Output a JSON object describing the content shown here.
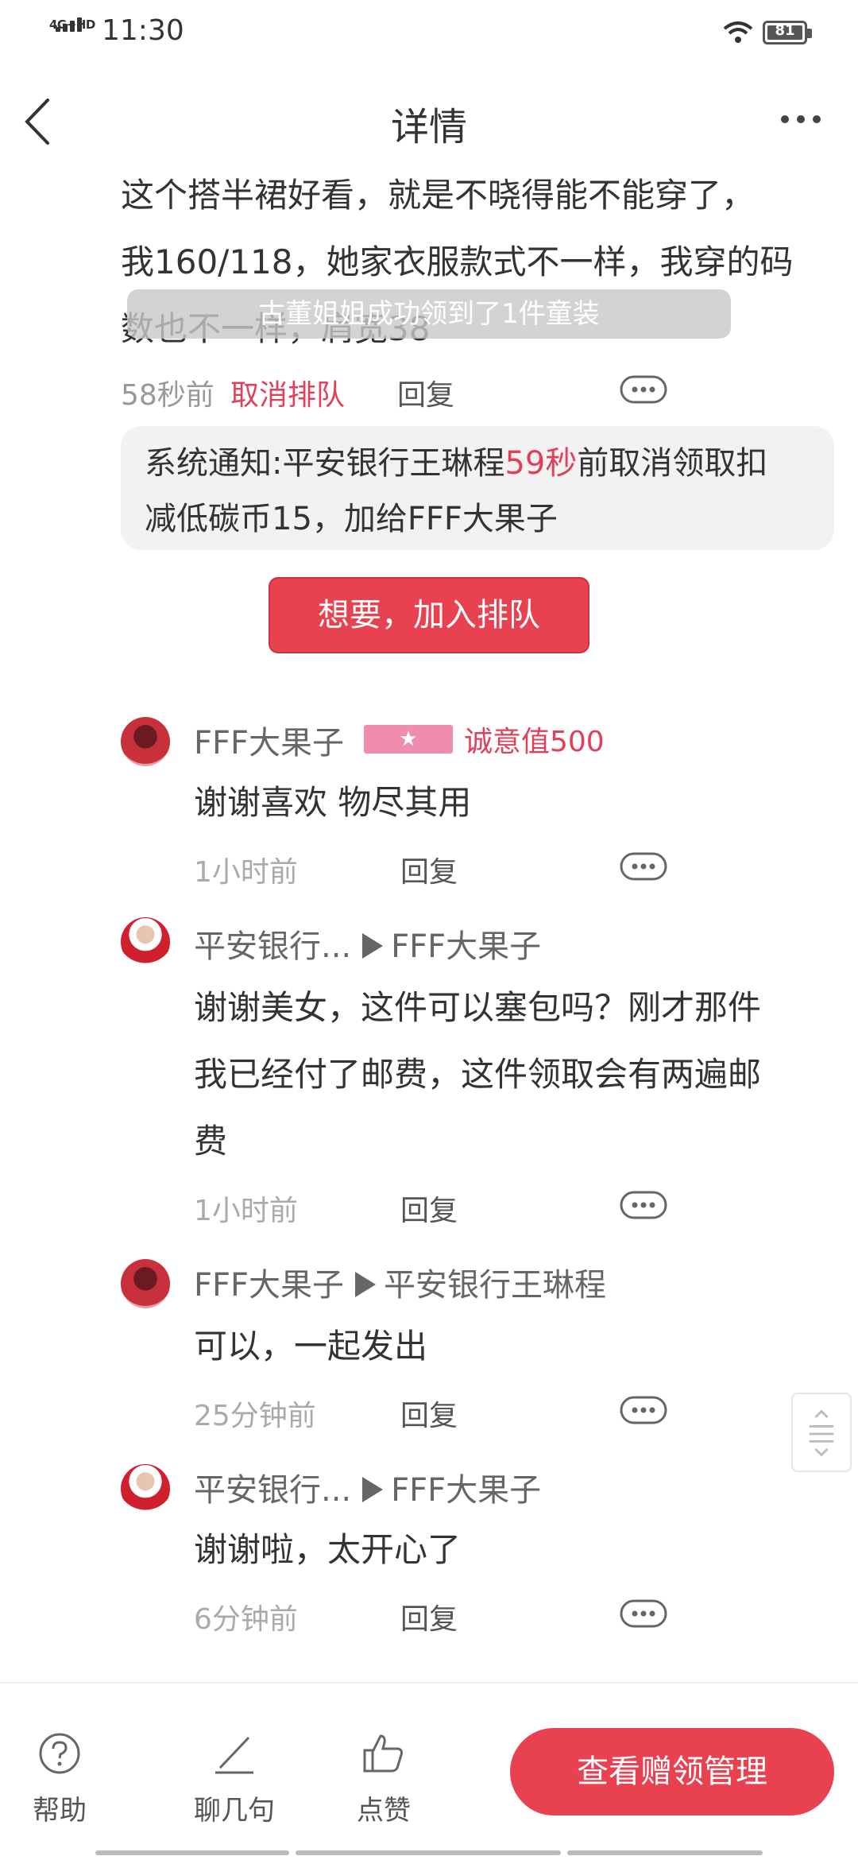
{
  "status_bar": {
    "network": "4G+HD",
    "time": "11:30",
    "battery": "81"
  },
  "nav": {
    "title": "详情"
  },
  "post": {
    "text_lines": [
      "这个搭半裙好看，就是不晓得能不能穿了，",
      "我160/118，她家衣服款式不一样，我穿的码",
      "数也不一样，肩宽38"
    ],
    "time": "58秒前",
    "cancel_label": "取消排队",
    "reply_label": "回复"
  },
  "toast": "古董姐姐成功领到了1件童装",
  "notice": {
    "prefix": "系统通知:平安银行王琳程",
    "highlight": "59秒",
    "suffix": "前取消领取扣",
    "line2": "减低碳币15，加给FFF大果子"
  },
  "want_button": "想要，加入排队",
  "comments": [
    {
      "user": "FFF大果子",
      "badge": "★",
      "sincerity": "诚意值500",
      "lines": [
        "谢谢喜欢 物尽其用"
      ],
      "time": "1小时前",
      "reply_label": "回复"
    },
    {
      "user": "平安银行...",
      "target": "FFF大果子",
      "lines": [
        "谢谢美女，这件可以塞包吗？刚才那件",
        "我已经付了邮费，这件领取会有两遍邮",
        "费"
      ],
      "time": "1小时前",
      "reply_label": "回复"
    },
    {
      "user": "FFF大果子",
      "target": "平安银行王琳程",
      "lines": [
        "可以，一起发出"
      ],
      "time": "25分钟前",
      "reply_label": "回复"
    },
    {
      "user": "平安银行...",
      "target": "FFF大果子",
      "lines": [
        "谢谢啦，太开心了"
      ],
      "time": "6分钟前",
      "reply_label": "回复"
    }
  ],
  "bottom_bar": {
    "help": "帮助",
    "chat": "聊几句",
    "like": "点赞",
    "manage": "查看赠领管理"
  },
  "colors": {
    "accent": "#e8414f",
    "highlight_text": "#e0405a",
    "badge_pink": "#f08cad"
  },
  "icons": [
    "back-arrow-icon",
    "more-dots-icon",
    "help-circle-icon",
    "pen-icon",
    "thumbs-up-icon",
    "scroll-handle-icon"
  ]
}
